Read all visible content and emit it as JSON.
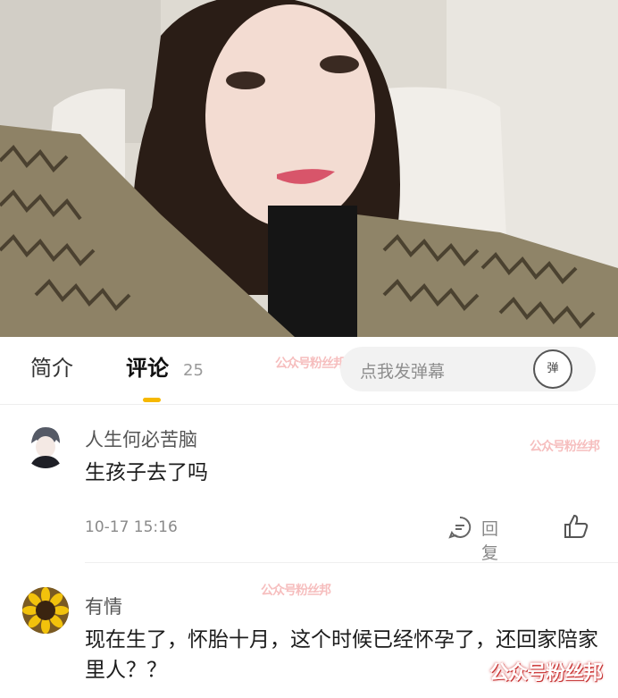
{
  "tabs": {
    "intro": "简介",
    "comments": "评论",
    "comment_count": "25"
  },
  "danmaku": {
    "placeholder": "点我发弹幕",
    "button_label": "弹"
  },
  "comments": [
    {
      "user": "人生何必苦脑",
      "text": "生孩子去了吗",
      "time": "10-17 15:16",
      "reply_label": "回复"
    },
    {
      "user": "有情",
      "text": "现在生了，怀胎十月，这个时候已经怀孕了，还回家陪家里人？？"
    }
  ],
  "watermark": "公众号粉丝邦",
  "colors": {
    "accent": "#f6b800",
    "muted": "#999999"
  }
}
